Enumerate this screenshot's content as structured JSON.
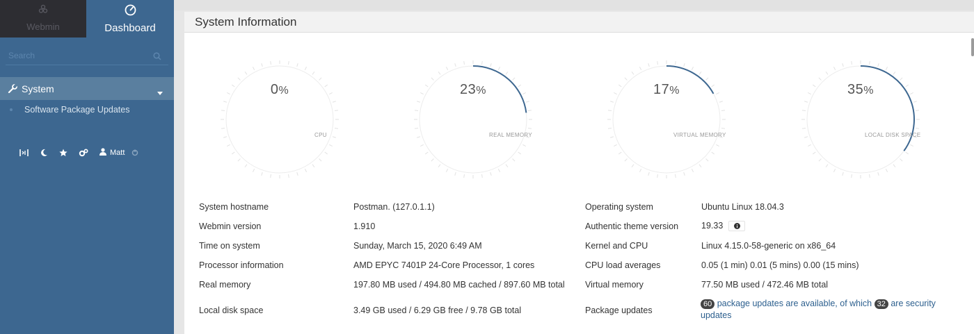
{
  "sidebar": {
    "tabs": {
      "webmin": "Webmin",
      "dashboard": "Dashboard"
    },
    "search_placeholder": "Search",
    "menu": {
      "system": "System",
      "items": [
        "Software Package Updates"
      ]
    },
    "toolbar": {
      "user": "Matt"
    }
  },
  "panel": {
    "title": "System Information",
    "gauges": [
      {
        "label": "CPU",
        "value": "0",
        "percent": 0
      },
      {
        "label": "REAL MEMORY",
        "value": "23",
        "percent": 23
      },
      {
        "label": "VIRTUAL MEMORY",
        "value": "17",
        "percent": 17
      },
      {
        "label": "LOCAL DISK SPACE",
        "value": "35",
        "percent": 35
      }
    ],
    "gauge_unit": "%",
    "info_left": [
      {
        "key": "System hostname",
        "value": "Postman. (127.0.1.1)"
      },
      {
        "key": "Webmin version",
        "value": "1.910"
      },
      {
        "key": "Time on system",
        "value": "Sunday, March 15, 2020 6:49 AM"
      },
      {
        "key": "Processor information",
        "value": "AMD EPYC 7401P 24-Core Processor, 1 cores"
      },
      {
        "key": "Real memory",
        "value": "197.80 MB used / 494.80 MB cached / 897.60 MB total"
      },
      {
        "key": "Local disk space",
        "value": "3.49 GB used / 6.29 GB free / 9.78 GB total"
      }
    ],
    "info_right": [
      {
        "key": "Operating system",
        "value": "Ubuntu Linux 18.04.3"
      },
      {
        "key": "Authentic theme version",
        "value": "19.33"
      },
      {
        "key": "Kernel and CPU",
        "value": "Linux 4.15.0-58-generic on x86_64"
      },
      {
        "key": "CPU load averages",
        "value": "0.05 (1 min) 0.01 (5 mins) 0.00 (15 mins)"
      },
      {
        "key": "Virtual memory",
        "value": "77.50 MB used / 472.46 MB total"
      }
    ],
    "package_updates": {
      "key": "Package updates",
      "count": "60",
      "text1": "package updates are available, of which",
      "security_count": "32",
      "text2": "are security updates"
    }
  },
  "colors": {
    "sidebar": "#3d6790",
    "sidebar_dark": "#2d2d32",
    "active_item": "#5a7f9f",
    "gauge_arc": "#3d6790",
    "link": "#2c5f8e"
  }
}
